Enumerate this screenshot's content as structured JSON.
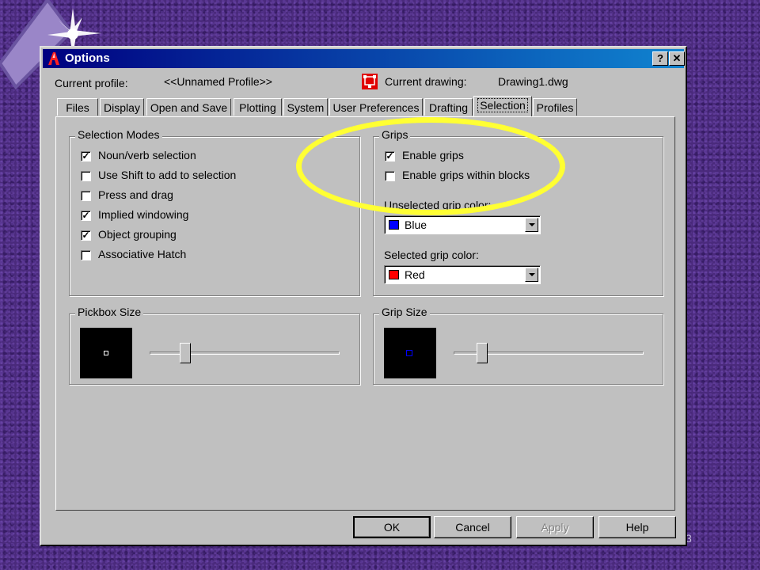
{
  "window": {
    "title": "Options"
  },
  "header": {
    "current_profile_label": "Current profile:",
    "current_profile_value": "<<Unnamed Profile>>",
    "current_drawing_label": "Current drawing:",
    "current_drawing_value": "Drawing1.dwg"
  },
  "tabs": [
    {
      "label": "Files"
    },
    {
      "label": "Display"
    },
    {
      "label": "Open and Save"
    },
    {
      "label": "Plotting"
    },
    {
      "label": "System"
    },
    {
      "label": "User Preferences"
    },
    {
      "label": "Drafting"
    },
    {
      "label": "Selection",
      "active": true
    },
    {
      "label": "Profiles"
    }
  ],
  "selection_modes": {
    "title": "Selection Modes",
    "items": [
      {
        "label": "Noun/verb selection",
        "checked": true
      },
      {
        "label": "Use Shift to add to selection",
        "checked": false
      },
      {
        "label": "Press and drag",
        "checked": false
      },
      {
        "label": "Implied windowing",
        "checked": true
      },
      {
        "label": "Object grouping",
        "checked": true
      },
      {
        "label": "Associative Hatch",
        "checked": false
      }
    ]
  },
  "grips": {
    "title": "Grips",
    "items": [
      {
        "label": "Enable grips",
        "checked": true
      },
      {
        "label": "Enable grips within blocks",
        "checked": false
      }
    ],
    "unselected_label": "Unselected grip color:",
    "unselected_value": "Blue",
    "unselected_color": "#0000ff",
    "selected_label": "Selected grip color:",
    "selected_value": "Red",
    "selected_color": "#ff0000"
  },
  "pickbox": {
    "title": "Pickbox Size",
    "marker_color": "#ffffff",
    "level": 0.17
  },
  "grip_size": {
    "title": "Grip Size",
    "marker_color": "#0000ff",
    "level": 0.13
  },
  "buttons": {
    "ok": "OK",
    "cancel": "Cancel",
    "apply": "Apply",
    "help": "Help"
  },
  "title_buttons": {
    "help": "?",
    "close": "✕"
  },
  "slide_number": "3",
  "highlight_color": "#ffff33"
}
